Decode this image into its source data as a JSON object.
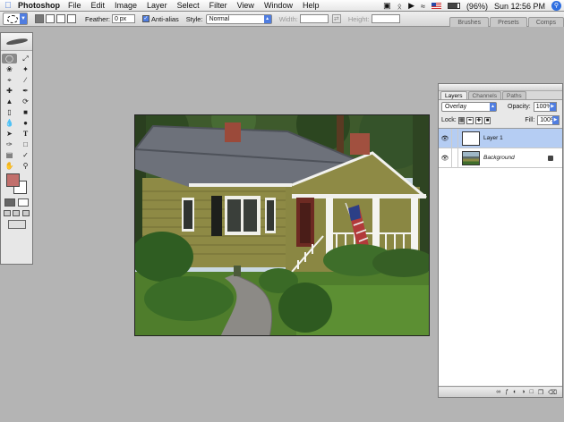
{
  "menubar": {
    "app_name": "Photoshop",
    "menus": [
      "File",
      "Edit",
      "Image",
      "Layer",
      "Select",
      "Filter",
      "View",
      "Window",
      "Help"
    ],
    "battery": "(96%)",
    "clock": "Sun 12:56 PM"
  },
  "options": {
    "feather_label": "Feather:",
    "feather_value": "0 px",
    "antialias_label": "Anti-alias",
    "style_label": "Style:",
    "style_value": "Normal",
    "width_label": "Width:",
    "height_label": "Height:",
    "well_tabs": [
      "Brushes",
      "Presets",
      "Comps"
    ]
  },
  "toolbox": {
    "foreground_color": "#c16f6c",
    "background_color": "#ffffff"
  },
  "layers_panel": {
    "tabs": [
      "Layers",
      "Channels",
      "Paths"
    ],
    "blend_mode": "Overlay",
    "opacity_label": "Opacity:",
    "opacity_value": "100%",
    "lock_label": "Lock:",
    "fill_label": "Fill:",
    "fill_value": "100%",
    "layers": [
      {
        "name": "Layer 1",
        "active": true
      },
      {
        "name": "Background",
        "active": false
      }
    ]
  },
  "colors": {
    "workspace": "#b4b4b4",
    "selection": "#b5cdf3",
    "accent": "#4f7de0"
  }
}
